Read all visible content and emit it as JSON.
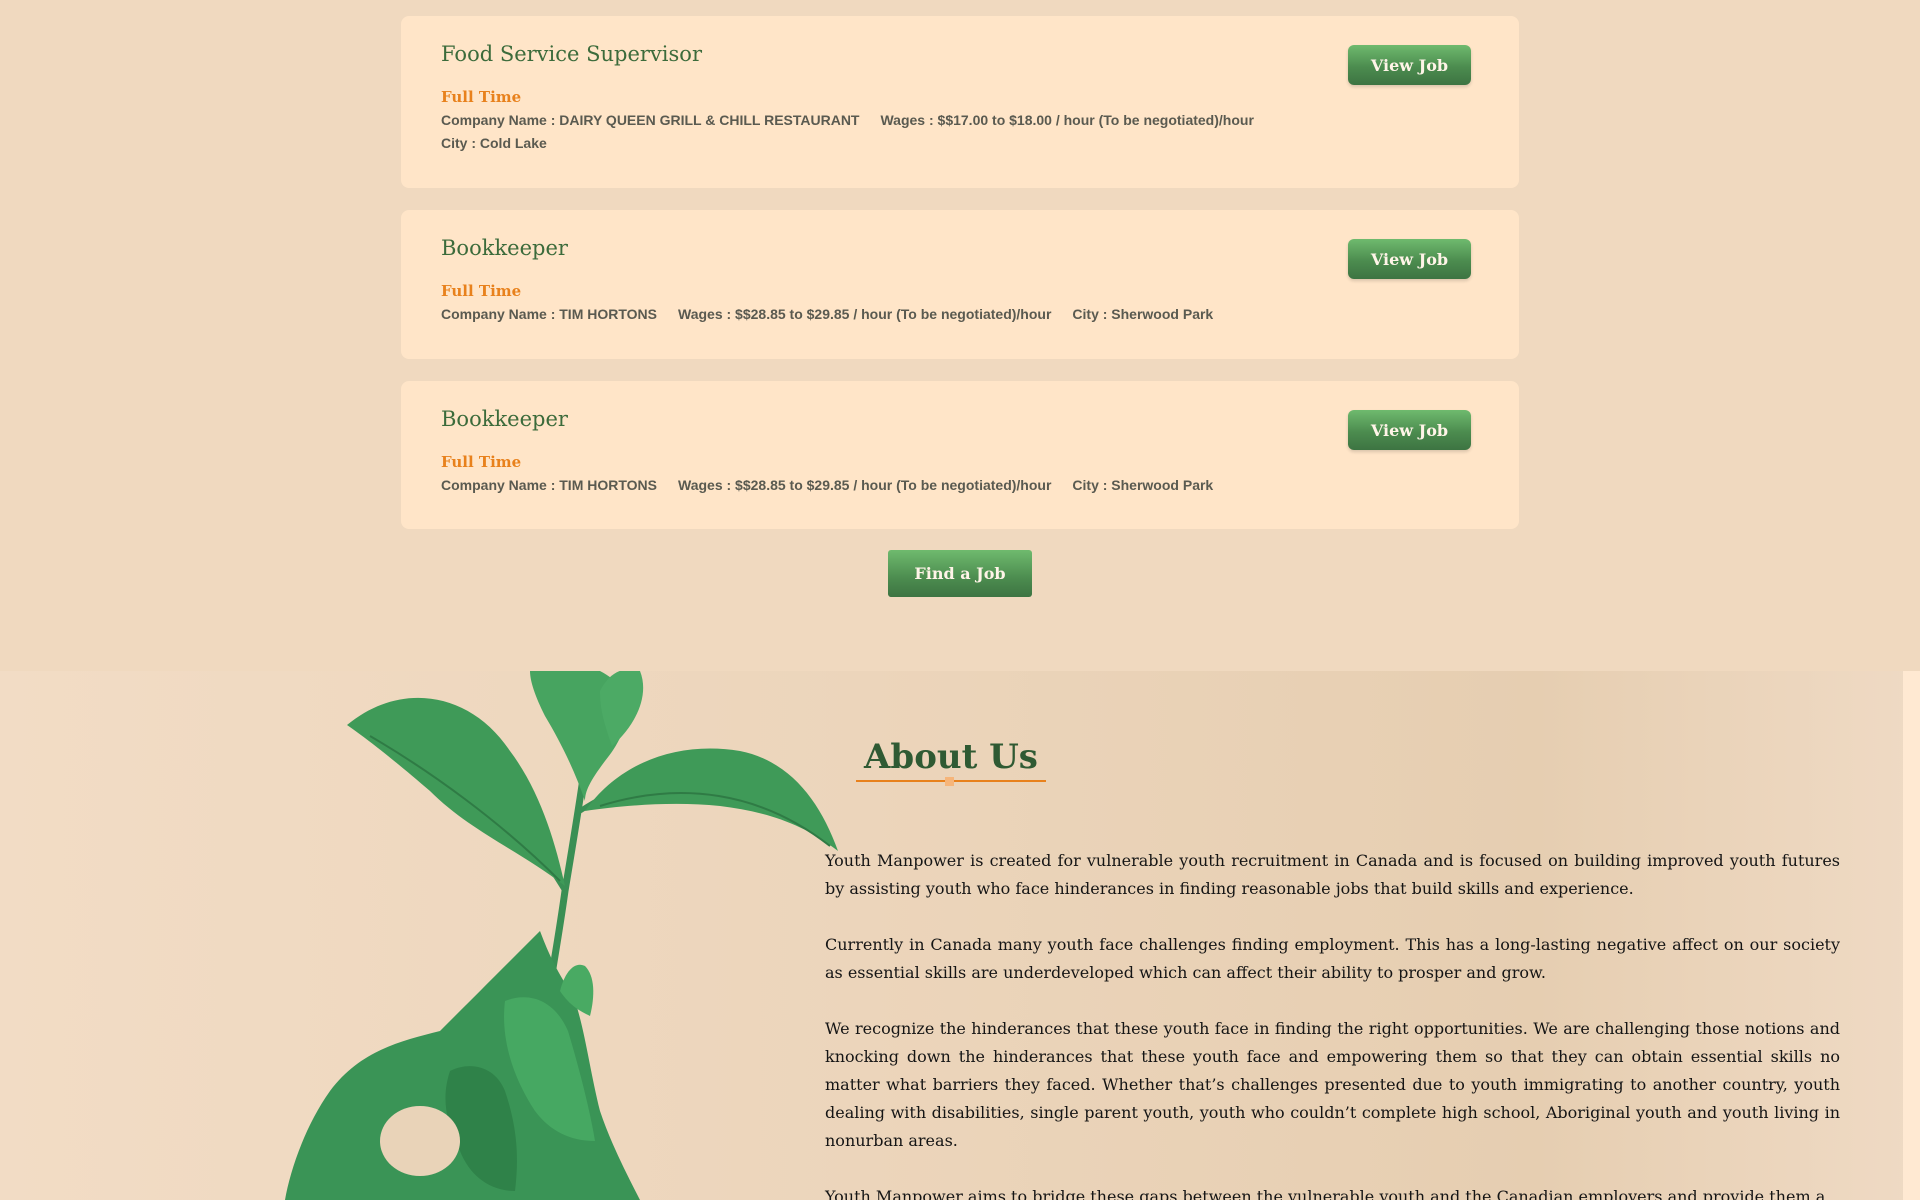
{
  "jobs": [
    {
      "title": "Food Service Supervisor",
      "type": "Full Time",
      "company": "Company Name : DAIRY QUEEN GRILL & CHILL RESTAURANT",
      "wages": "Wages : $$17.00 to $18.00 / hour (To be negotiated)/hour",
      "city": "City : Cold Lake",
      "button": "View Job"
    },
    {
      "title": "Bookkeeper",
      "type": "Full Time",
      "company": "Company Name : TIM HORTONS",
      "wages": "Wages : $$28.85 to $29.85 / hour (To be negotiated)/hour",
      "city": "City : Sherwood Park",
      "button": "View Job"
    },
    {
      "title": "Bookkeeper",
      "type": "Full Time",
      "company": "Company Name : TIM HORTONS",
      "wages": "Wages : $$28.85 to $29.85 / hour (To be negotiated)/hour",
      "city": "City : Sherwood Park",
      "button": "View Job"
    }
  ],
  "find_job_button": "Find a Job",
  "about": {
    "title": "About Us",
    "paragraphs": [
      "Youth Manpower is created for vulnerable youth recruitment in Canada and is focused on building improved youth futures by assisting youth who face hinderances in finding reasonable jobs that build skills and experience.",
      "Currently in Canada many youth face challenges finding employment. This has a long-lasting negative affect on our society as essential skills are underdeveloped which can affect their ability to prosper and grow.",
      "We recognize the hinderances that these youth face in finding the right opportunities. We are challenging those notions and knocking down the hinderances that these youth face and empowering them so that they can obtain essential skills no matter what barriers they faced. Whether that’s challenges presented due to youth immigrating to another country, youth dealing with disabilities, single parent youth, youth who couldn’t complete high school, Aboriginal youth and youth living in nonurban areas.",
      "Youth Manpower aims to bridge these gaps between the vulnerable youth and the Canadian employers and provide them a"
    ]
  },
  "colors": {
    "page_bg": "#f0d9bf",
    "card_bg": "#ffe5c8",
    "title_green": "#3c6b3b",
    "job_type_orange": "#e8811c",
    "button_green": "#4c8c4f",
    "about_title_green": "#2f5a33",
    "plant_green": "#3d9a5a"
  }
}
